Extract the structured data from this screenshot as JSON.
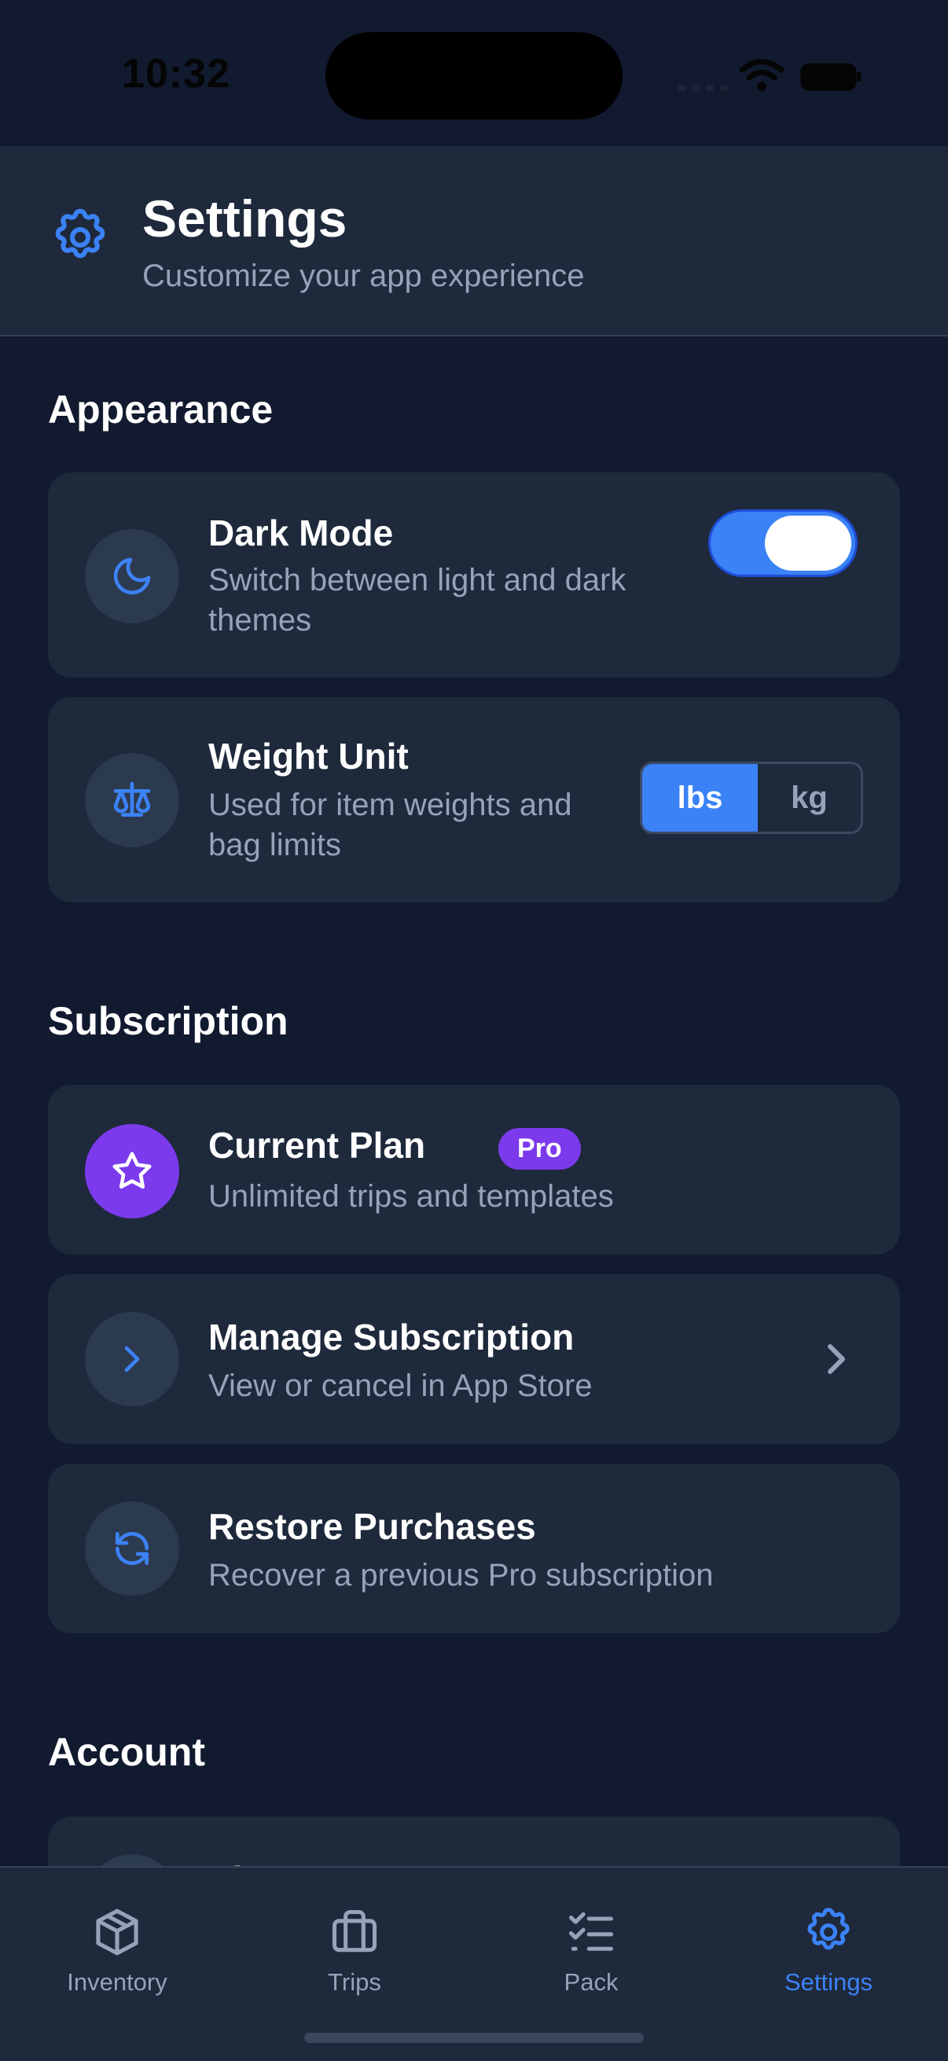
{
  "status_bar": {
    "time": "10:32"
  },
  "header": {
    "title": "Settings",
    "subtitle": "Customize your app experience",
    "icon": "gear-icon"
  },
  "sections": {
    "appearance": {
      "title": "Appearance",
      "dark_mode": {
        "title": "Dark Mode",
        "description": "Switch between light and dark themes",
        "icon": "moon-icon",
        "enabled": true
      },
      "weight_unit": {
        "title": "Weight Unit",
        "description": "Used for item weights and bag limits",
        "icon": "scale-icon",
        "options": [
          "lbs",
          "kg"
        ],
        "selected": "lbs"
      }
    },
    "subscription": {
      "title": "Subscription",
      "current_plan": {
        "title": "Current Plan",
        "badge": "Pro",
        "description": "Unlimited trips and templates",
        "icon": "star-icon"
      },
      "manage": {
        "title": "Manage Subscription",
        "description": "View or cancel in App Store",
        "icon": "chevron-right-icon"
      },
      "restore": {
        "title": "Restore Purchases",
        "description": "Recover a previous Pro subscription",
        "icon": "refresh-icon"
      }
    },
    "account": {
      "title": "Account",
      "first_item": "Sign Up"
    }
  },
  "tabs": [
    {
      "label": "Inventory",
      "icon": "box-icon",
      "active": false
    },
    {
      "label": "Trips",
      "icon": "briefcase-icon",
      "active": false
    },
    {
      "label": "Pack",
      "icon": "checklist-icon",
      "active": false
    },
    {
      "label": "Settings",
      "icon": "gear-icon",
      "active": true
    }
  ],
  "colors": {
    "background": "#111a2e",
    "card": "#1e293b",
    "accent": "#3b82f6",
    "pro": "#7c3aed",
    "muted_text": "#94a3b8"
  }
}
